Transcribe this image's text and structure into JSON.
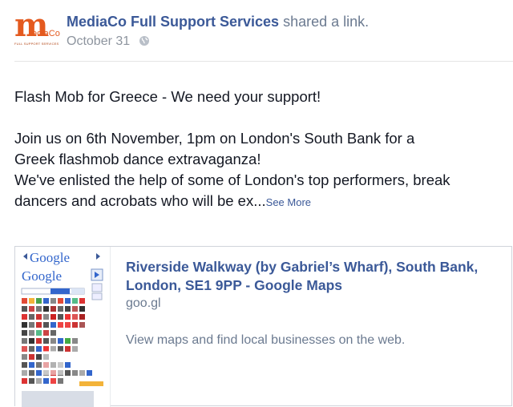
{
  "post": {
    "author": "MediaCo Full Support Services",
    "action": "shared a link.",
    "date": "October 31",
    "privacy_icon": "globe-icon",
    "avatar": {
      "logo_letter": "m",
      "logo_text": "ediaCo",
      "logo_tagline": "FULL SUPPORT SERVICES",
      "brand_color": "#e45a1f"
    }
  },
  "message": {
    "line1": "Flash Mob for Greece - We need your support!",
    "para2_line1": "Join us on 6th November, 1pm on London's South Bank for a",
    "para2_line2": "Greek flashmob dance extravaganza!",
    "para3_line1": "We've enlisted the help of some of London's top performers, break",
    "para3_line2": "dancers and acrobats who will be ex...",
    "see_more": "See More"
  },
  "attachment": {
    "title": "Riverside Walkway (by Gabriel’s Wharf), South Bank, London, SE1 9PP - Google Maps",
    "domain": "goo.gl",
    "description": "View maps and find local businesses on the web.",
    "thumbnail": {
      "word1": "Google",
      "word2": "Google"
    }
  },
  "colors": {
    "link": "#3b5998",
    "text": "#141823",
    "muted": "#6b7a90"
  }
}
